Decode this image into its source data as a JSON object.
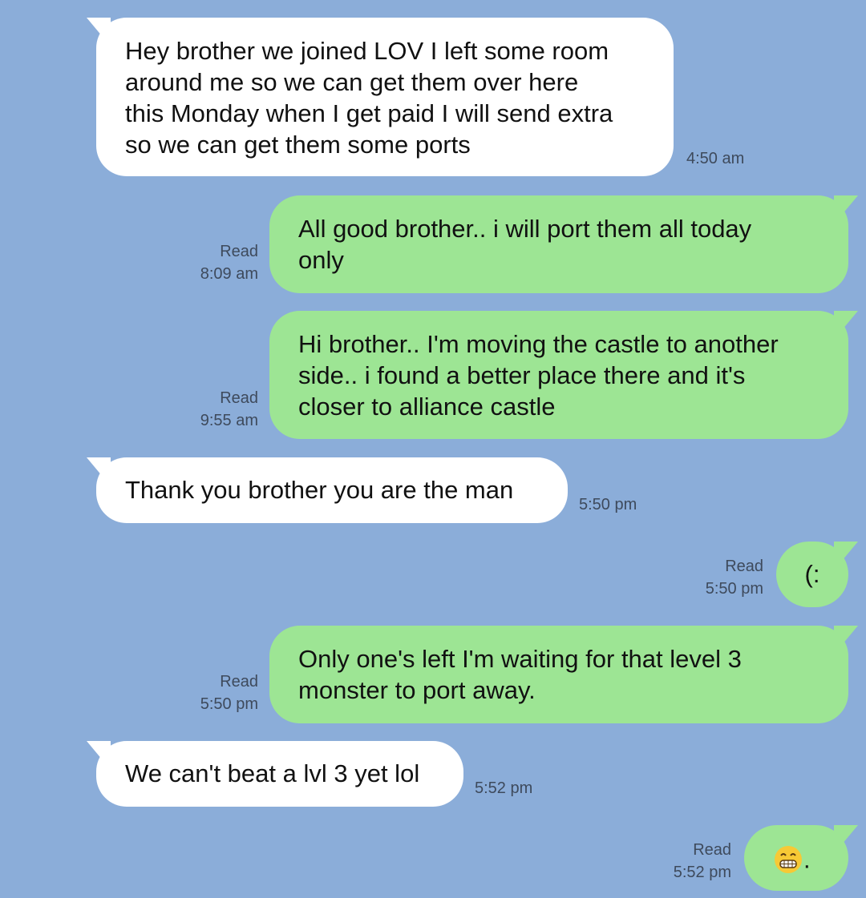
{
  "colors": {
    "background": "#8badd9",
    "incoming_bubble": "#ffffff",
    "outgoing_bubble": "#9de594",
    "meta_text": "#3e4a5c"
  },
  "messages": [
    {
      "direction": "incoming",
      "text": "Hey brother we joined LOV I left some room\naround me so we can get them over here\nthis Monday when I get paid I will send extra\nso we can get them some ports",
      "time": "4:50 am"
    },
    {
      "direction": "outgoing",
      "text": "All good brother.. i will port them all today\nonly",
      "read_label": "Read",
      "time": "8:09 am"
    },
    {
      "direction": "outgoing",
      "text": "Hi brother.. I'm moving the castle to another\nside.. i found a better place there and it's\ncloser to alliance castle",
      "read_label": "Read",
      "time": "9:55 am"
    },
    {
      "direction": "incoming",
      "text": "Thank you brother you are the man",
      "time": "5:50 pm"
    },
    {
      "direction": "outgoing",
      "text": "(:",
      "read_label": "Read",
      "time": "5:50 pm"
    },
    {
      "direction": "outgoing",
      "text": "Only one's left I'm waiting for that level 3\nmonster to port away.",
      "read_label": "Read",
      "time": "5:50 pm"
    },
    {
      "direction": "incoming",
      "text": "We can't beat a lvl 3 yet lol",
      "time": "5:52 pm"
    },
    {
      "direction": "outgoing",
      "emoji": "grinning-face-emoji",
      "text": ".",
      "read_label": "Read",
      "time": "5:52 pm"
    }
  ]
}
